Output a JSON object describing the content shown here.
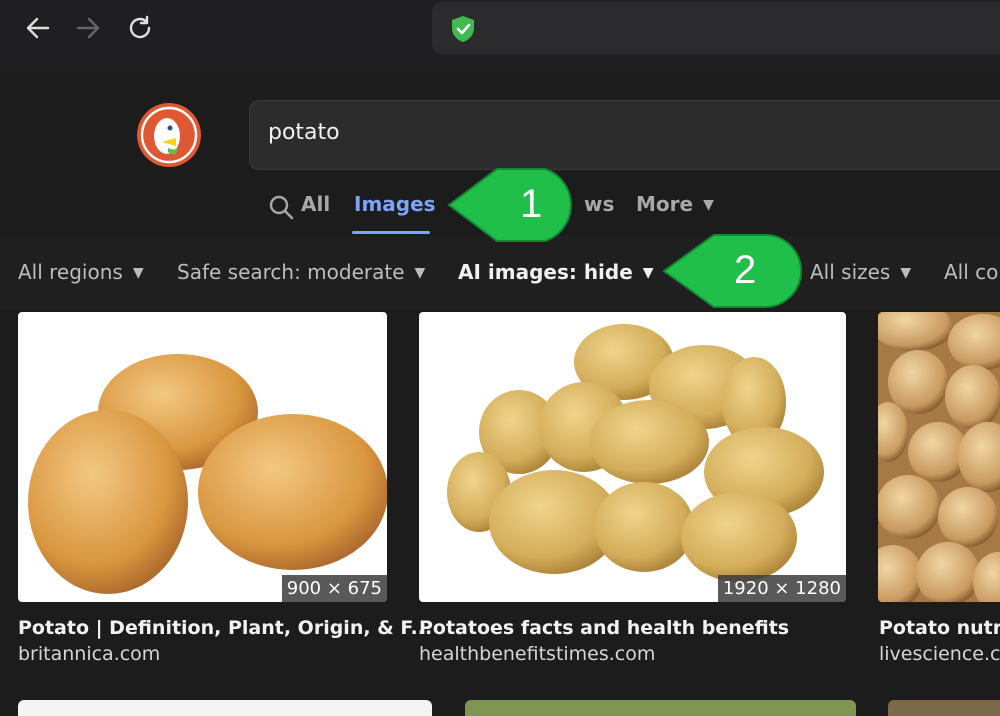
{
  "browser": {
    "back_icon": "arrow-left-icon",
    "forward_icon": "arrow-right-icon",
    "reload_icon": "reload-icon",
    "security_icon": "shield-check-icon"
  },
  "search": {
    "query": "potato",
    "logo_icon": "duckduckgo-logo"
  },
  "tabs": {
    "all": "All",
    "images": "Images",
    "news_partial": "ws",
    "more": "More"
  },
  "filters": {
    "regions": "All regions",
    "safe_search": "Safe search: moderate",
    "ai_images": "AI images: hide",
    "sizes": "All sizes",
    "colors_partial": "All co"
  },
  "results": [
    {
      "title": "Potato | Definition, Plant, Origin, & F...",
      "source": "britannica.com",
      "dimensions": "900 × 675"
    },
    {
      "title": "Potatoes facts and health benefits",
      "source": "healthbenefitstimes.com",
      "dimensions": "1920 × 1280"
    },
    {
      "title": "Potato nutriti",
      "source": "livescience.c"
    }
  ],
  "callouts": {
    "one": "1",
    "two": "2"
  },
  "colors": {
    "accent": "#7ea3ff",
    "callout_green": "#1fbf4a"
  }
}
